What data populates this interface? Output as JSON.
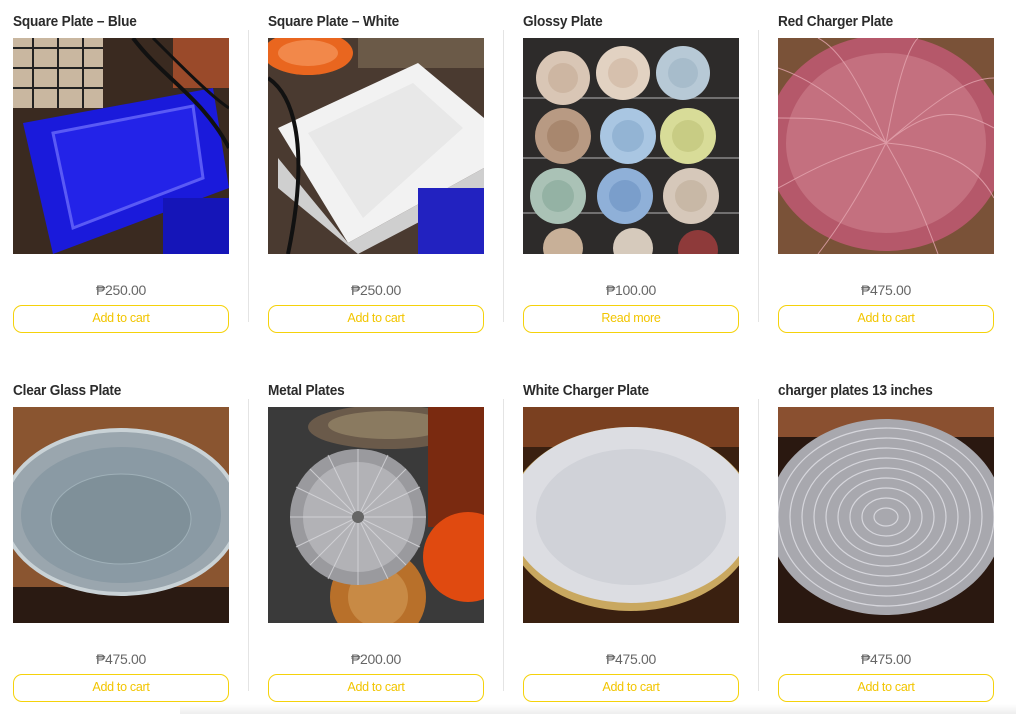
{
  "colors": {
    "accent": "#f5d20b",
    "button_text": "#f2c500",
    "title_text": "#2b2b2b",
    "price_text": "#666666"
  },
  "products": [
    {
      "title": "Square Plate – Blue",
      "price": "₱250.00",
      "button": "Add to cart",
      "image": "blue-square-plate"
    },
    {
      "title": "Square Plate – White",
      "price": "₱250.00",
      "button": "Add to cart",
      "image": "white-square-plate"
    },
    {
      "title": "Glossy Plate",
      "price": "₱100.00",
      "button": "Read more",
      "image": "glossy-plates-rack"
    },
    {
      "title": "Red Charger Plate",
      "price": "₱475.00",
      "button": "Add to cart",
      "image": "red-charger-plate"
    },
    {
      "title": "Clear Glass Plate",
      "price": "₱475.00",
      "button": "Add to cart",
      "image": "clear-glass-plate"
    },
    {
      "title": "Metal Plates",
      "price": "₱200.00",
      "button": "Add to cart",
      "image": "metal-plates"
    },
    {
      "title": "White Charger Plate",
      "price": "₱475.00",
      "button": "Add to cart",
      "image": "white-charger-plate"
    },
    {
      "title": "charger plates 13 inches",
      "price": "₱475.00",
      "button": "Add to cart",
      "image": "silver-charger-plate"
    }
  ]
}
